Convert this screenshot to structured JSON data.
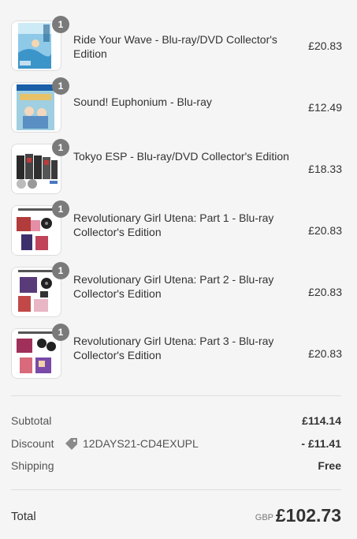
{
  "items": [
    {
      "name": "Ride Your Wave - Blu-ray/DVD Collector's Edition",
      "price": "£20.83",
      "quantity": "1"
    },
    {
      "name": "Sound! Euphonium - Blu-ray",
      "price": "£12.49",
      "quantity": "1"
    },
    {
      "name": "Tokyo ESP - Blu-ray/DVD Collector's Edition",
      "price": "£18.33",
      "quantity": "1"
    },
    {
      "name": "Revolutionary Girl Utena: Part 1 - Blu-ray Collector's Edition",
      "price": "£20.83",
      "quantity": "1"
    },
    {
      "name": "Revolutionary Girl Utena: Part 2 - Blu-ray Collector's Edition",
      "price": "£20.83",
      "quantity": "1"
    },
    {
      "name": "Revolutionary Girl Utena: Part 3 - Blu-ray Collector's Edition",
      "price": "£20.83",
      "quantity": "1"
    }
  ],
  "summary": {
    "subtotal_label": "Subtotal",
    "subtotal_value": "£114.14",
    "discount_label": "Discount",
    "discount_code": "12DAYS21-CD4EXUPL",
    "discount_value": "- £11.41",
    "shipping_label": "Shipping",
    "shipping_value": "Free"
  },
  "total": {
    "label": "Total",
    "currency": "GBP",
    "value": "£102.73"
  },
  "icons": {
    "discount": "tag-icon"
  },
  "colors": {
    "badge": "#7a7a7a",
    "background": "#f5f5f5",
    "divider": "#dedede"
  }
}
